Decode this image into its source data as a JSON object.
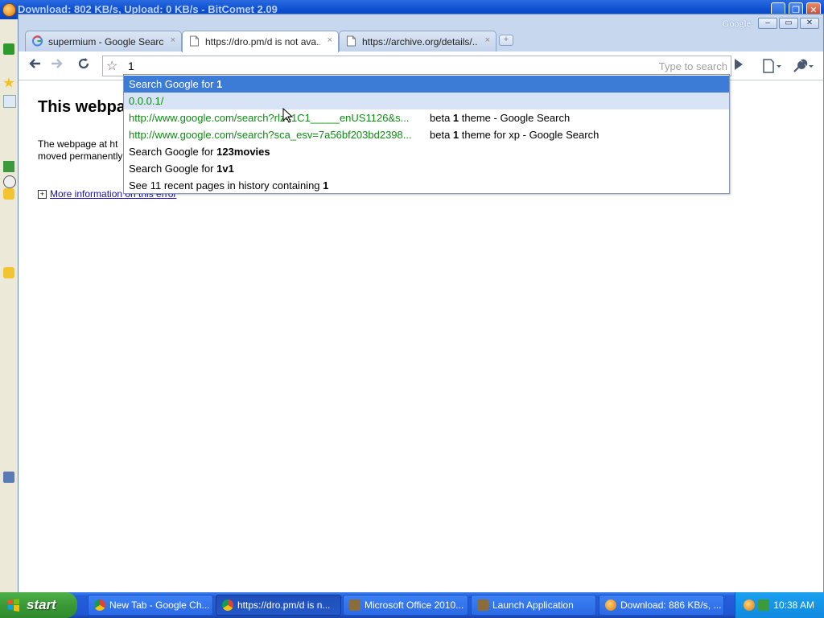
{
  "bg_window": {
    "title": "Download: 802 KB/s, Upload: 0 KB/s - BitComet 2.09"
  },
  "chrome": {
    "brand_label": "Google",
    "tabs": [
      {
        "label": "supermium - Google Search",
        "icon": "google-icon"
      },
      {
        "label": "https://dro.pm/d is not ava...",
        "icon": "page-icon"
      },
      {
        "label": "https://archive.org/details/...",
        "icon": "page-icon"
      }
    ],
    "tab_close": "×",
    "new_tab": "+",
    "omnibox": {
      "value": "1",
      "search_hint": "Type to search"
    }
  },
  "page": {
    "heading": "This webpa",
    "message_line1": "The webpage at ht",
    "message_line2": "moved permanently",
    "more_info_link": "More information on this error"
  },
  "dropdown": {
    "suggestions": [
      {
        "type": "search",
        "prefix": "Search Google for ",
        "bold": "1",
        "state": "selected"
      },
      {
        "type": "url",
        "url": "0.0.0.1/",
        "state": "hover"
      },
      {
        "type": "history",
        "url": "http://www.google.com/search?rlz=1C1_____enUS1126&s...",
        "title_pre": "beta ",
        "title_bold": "1",
        "title_post": " theme - Google Search"
      },
      {
        "type": "history",
        "url": "http://www.google.com/search?sca_esv=7a56bf203bd2398...",
        "title_pre": "beta ",
        "title_bold": "1",
        "title_post": " theme for xp - Google Search"
      },
      {
        "type": "search",
        "prefix": "Search Google for ",
        "bold": "123movies"
      },
      {
        "type": "search",
        "prefix": "Search Google for ",
        "bold": "1v1"
      },
      {
        "type": "history_count",
        "prefix": "See 11 recent pages in history containing ",
        "bold": "1"
      }
    ]
  },
  "taskbar": {
    "start_label": "start",
    "tasks": [
      {
        "label": "New Tab - Google Ch...",
        "icon": "chrome-icon"
      },
      {
        "label": "https://dro.pm/d is n...",
        "icon": "chrome-icon",
        "active": true
      },
      {
        "label": "Microsoft Office 2010...",
        "icon": "installer-icon"
      },
      {
        "label": "Launch Application",
        "icon": "installer-icon"
      },
      {
        "label": "Download: 886 KB/s, ...",
        "icon": "bitcomet-icon"
      }
    ],
    "clock": "10:38 AM"
  },
  "colors": {
    "selected_row": "#3d7cd6",
    "url_green": "#0b8d12",
    "xp_blue": "#245ddb",
    "start_green": "#3a9a36"
  }
}
